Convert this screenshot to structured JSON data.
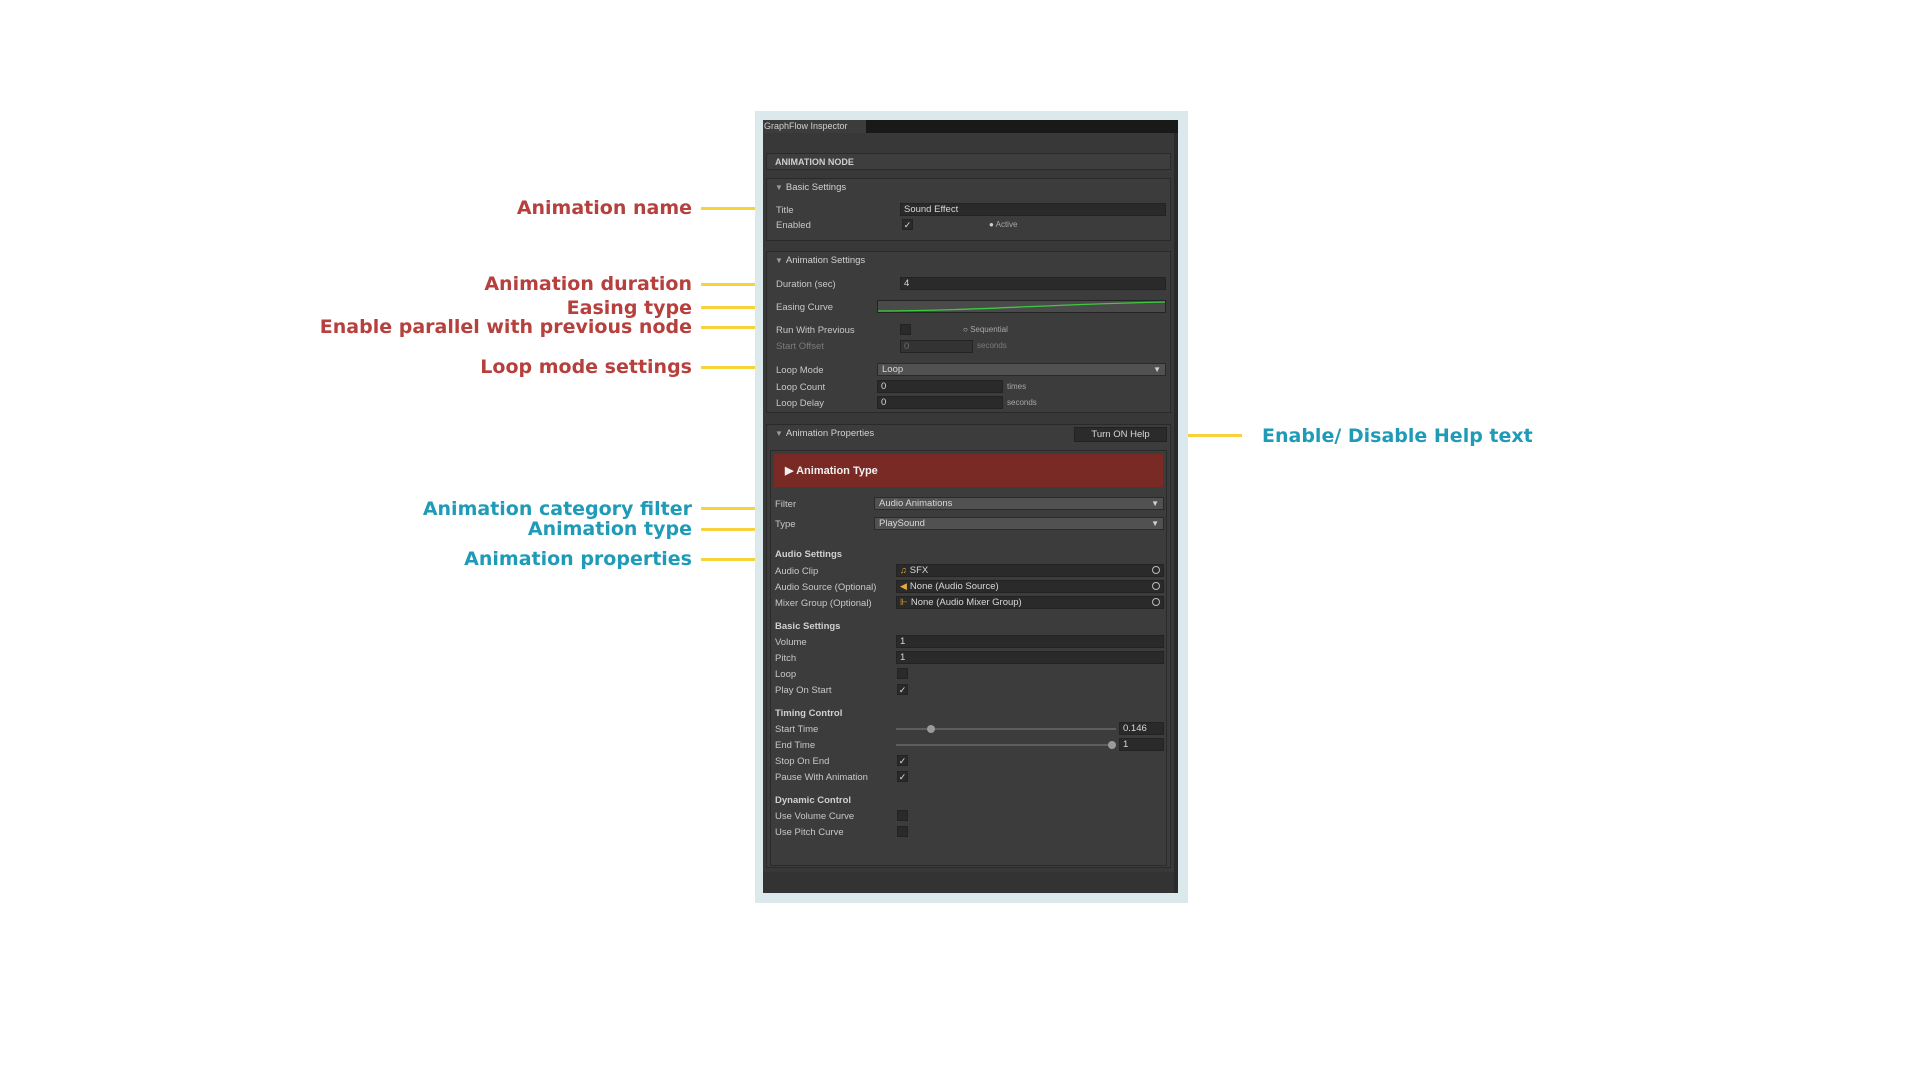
{
  "window": {
    "title": "GraphFlow Inspector"
  },
  "node_header": "ANIMATION NODE",
  "basic_settings": {
    "header": "Basic Settings",
    "title_label": "Title",
    "title_value": "Sound Effect",
    "enabled_label": "Enabled",
    "enabled_checked": "✓",
    "active_label": "Active"
  },
  "animation_settings": {
    "header": "Animation Settings",
    "duration_label": "Duration (sec)",
    "duration_value": "4",
    "easing_label": "Easing Curve",
    "run_with_previous_label": "Run With Previous",
    "sequential_label": "Sequential",
    "start_offset_label": "Start Offset",
    "start_offset_value": "0",
    "seconds_unit": "seconds",
    "loop_mode_label": "Loop Mode",
    "loop_mode_value": "Loop",
    "loop_count_label": "Loop Count",
    "loop_count_value": "0",
    "times_unit": "times",
    "loop_delay_label": "Loop Delay",
    "loop_delay_value": "0",
    "loop_delay_unit": "seconds"
  },
  "animation_properties": {
    "header": "Animation Properties",
    "help_button": "Turn ON Help",
    "type_banner": "Animation Type",
    "filter_label": "Filter",
    "filter_value": "Audio Animations",
    "type_label": "Type",
    "type_value": "PlaySound",
    "audio_settings": {
      "header": "Audio Settings",
      "clip_label": "Audio Clip",
      "clip_value": "SFX",
      "source_label": "Audio Source (Optional)",
      "source_value": "None (Audio Source)",
      "mixer_label": "Mixer Group (Optional)",
      "mixer_value": "None (Audio Mixer Group)"
    },
    "basic": {
      "header": "Basic Settings",
      "volume_label": "Volume",
      "volume_value": "1",
      "pitch_label": "Pitch",
      "pitch_value": "1",
      "loop_label": "Loop",
      "play_on_start_label": "Play On Start",
      "play_on_start_checked": "✓"
    },
    "timing": {
      "header": "Timing Control",
      "start_time_label": "Start Time",
      "start_time_value": "0.146",
      "start_time_fraction": 0.146,
      "end_time_label": "End Time",
      "end_time_value": "1",
      "end_time_fraction": 1,
      "stop_on_end_label": "Stop On End",
      "stop_on_end_checked": "✓",
      "pause_with_animation_label": "Pause With Animation",
      "pause_with_animation_checked": "✓"
    },
    "dynamic": {
      "header": "Dynamic Control",
      "use_volume_curve_label": "Use Volume Curve",
      "use_pitch_curve_label": "Use Pitch Curve"
    }
  },
  "annotations": {
    "animation_name": "Animation name",
    "animation_duration": "Animation duration",
    "easing_type": "Easing type",
    "enable_parallel": "Enable parallel with previous node",
    "loop_mode_settings": "Loop mode settings",
    "enable_help": "Enable/ Disable Help text",
    "category_filter": "Animation category filter",
    "animation_type": "Animation type",
    "animation_properties": "Animation properties"
  },
  "colors": {
    "annotation_red": "#b5403d",
    "annotation_teal": "#1f9bb8",
    "arrow_yellow": "#f7d23a",
    "banner_red": "#7a2a24",
    "curve_green": "#3ec83e"
  }
}
